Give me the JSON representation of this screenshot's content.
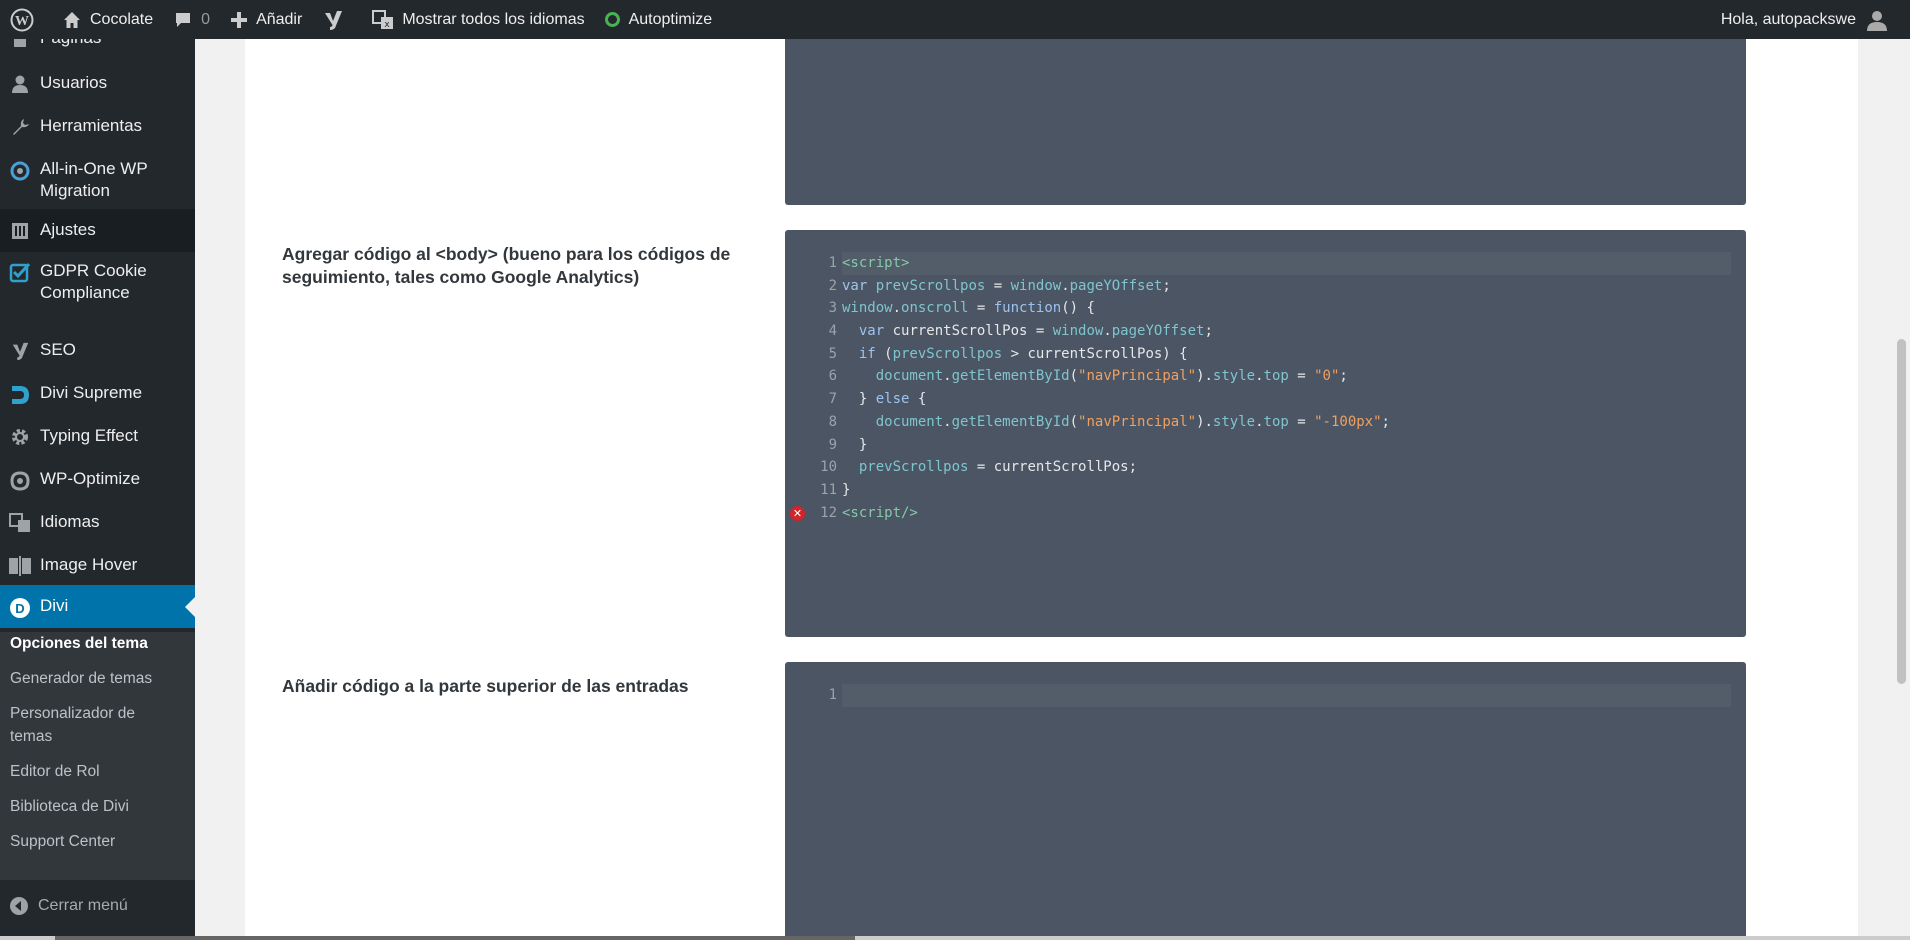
{
  "adminbar": {
    "site_name": "Cocolate",
    "comments_count": "0",
    "add_label": "Añadir",
    "languages_label": "Mostrar todos los idiomas",
    "autoptimize_label": "Autoptimize",
    "greeting": "Hola, autopackswe"
  },
  "sidebar": {
    "items": [
      {
        "label": "Páginas",
        "icon": "pages-icon"
      },
      {
        "label": "Usuarios",
        "icon": "user-icon"
      },
      {
        "label": "Herramientas",
        "icon": "wrench-icon"
      },
      {
        "label": "All-in-One WP Migration",
        "icon": "migration-icon"
      },
      {
        "label": "Ajustes",
        "icon": "settings-icon"
      },
      {
        "label": "GDPR Cookie Compliance",
        "icon": "checkbox-icon"
      },
      {
        "label": "SEO",
        "icon": "yoast-icon"
      },
      {
        "label": "Divi Supreme",
        "icon": "divi-supreme-icon"
      },
      {
        "label": "Typing Effect",
        "icon": "gear-icon"
      },
      {
        "label": "WP-Optimize",
        "icon": "wp-optimize-icon"
      },
      {
        "label": "Idiomas",
        "icon": "translate-icon"
      },
      {
        "label": "Image Hover",
        "icon": "image-hover-icon"
      },
      {
        "label": "Divi",
        "icon": "divi-icon"
      }
    ],
    "submenu": [
      {
        "label": "Opciones del tema"
      },
      {
        "label": "Generador de temas"
      },
      {
        "label": "Personalizador de temas"
      },
      {
        "label": "Editor de Rol"
      },
      {
        "label": "Biblioteca de Divi"
      },
      {
        "label": "Support Center"
      }
    ],
    "collapse_label": "Cerrar menú"
  },
  "options": [
    {
      "label": "Agregar código al <body> (bueno para los códigos de seguimiento, tales como Google Analytics)"
    },
    {
      "label": "Añadir código a la parte superior de las entradas"
    }
  ],
  "code_body": [
    {
      "n": "1",
      "text": "<script>"
    },
    {
      "n": "2",
      "text": "var prevScrollpos = window.pageYOffset;"
    },
    {
      "n": "3",
      "text": "window.onscroll = function() {"
    },
    {
      "n": "4",
      "text": "  var currentScrollPos = window.pageYOffset;"
    },
    {
      "n": "5",
      "text": "  if (prevScrollpos > currentScrollPos) {"
    },
    {
      "n": "6",
      "text": "    document.getElementById(\"navPrincipal\").style.top = \"0\";"
    },
    {
      "n": "7",
      "text": "  } else {"
    },
    {
      "n": "8",
      "text": "    document.getElementById(\"navPrincipal\").style.top = \"-100px\";"
    },
    {
      "n": "9",
      "text": "  }"
    },
    {
      "n": "10",
      "text": "  prevScrollpos = currentScrollPos;"
    },
    {
      "n": "11",
      "text": "}"
    },
    {
      "n": "12",
      "text": "<script/>"
    }
  ],
  "code_posts": [
    {
      "n": "1",
      "text": ""
    }
  ],
  "error_marker": "✕",
  "colors": {
    "adminbar": "#23282d",
    "accent": "#0073aa",
    "editor_bg": "#4b5563"
  }
}
